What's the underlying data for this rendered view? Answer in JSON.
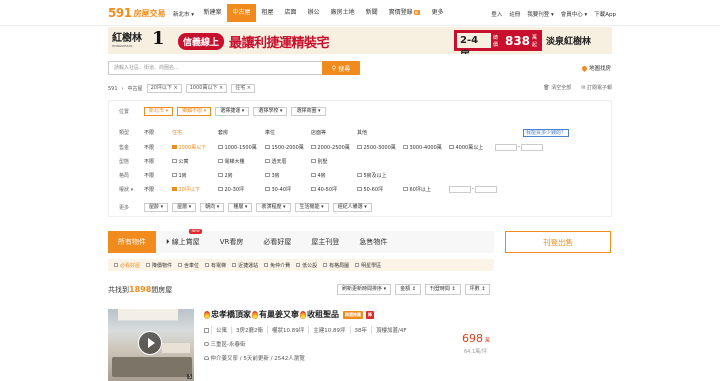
{
  "nav": {
    "logo_num": "591",
    "logo_text": "房屋交易",
    "city": "新北市 ▾",
    "links": [
      "新建案",
      "中古屋",
      "租屋",
      "店面",
      "辦公",
      "廠房土地",
      "新聞",
      "實價登錄",
      "更多"
    ],
    "new_badge": "新",
    "user": [
      "登入",
      "註冊",
      "我要刊登 ▾",
      "會員中心 ▾",
      "下載App"
    ]
  },
  "banner": {
    "brand": "紅樹林",
    "brand_num": "1",
    "brand_sub": "HONGSHULIN",
    "pill": "信義線上",
    "slogan": "最讓利捷運精裝宅",
    "rooms": "2-4房",
    "total_label": "總價",
    "price": "838",
    "price_unit": "萬起",
    "project": "淡泉紅樹林"
  },
  "search": {
    "placeholder": "請輸入社區、街道、商圈名...",
    "button": "搜尋",
    "map": "地圖找房"
  },
  "crumbs": {
    "items": [
      "591",
      "中古屋",
      "20坪以下 ×",
      "1000萬以下 ×",
      "住宅 ×"
    ],
    "right": [
      "清空全部",
      "訂閱電子報"
    ]
  },
  "filters": {
    "location_label": "位置",
    "location_sel": [
      "新北市 ▾",
      "鄉鎮不限 ▾",
      "選擇捷運 ▾",
      "選擇學校 ▾",
      "選擇商圈 ▾"
    ],
    "type_label": "類型",
    "type_opts": [
      "不限",
      "住宅",
      "套房",
      "車位",
      "店面等",
      "其他"
    ],
    "price_label": "售金",
    "price_opts": [
      "不限",
      "1000萬以下",
      "1000-1500萬",
      "1500-2000萬",
      "2000-2500萬",
      "2500-3000萬",
      "3000-4000萬",
      "4000萬以上"
    ],
    "calc": "我能買多少錢的？",
    "shape_label": "型態",
    "shape_opts": [
      "不限",
      "公寓",
      "電梯大樓",
      "透天厝",
      "別墅"
    ],
    "room_label": "格局",
    "room_opts": [
      "不限",
      "1房",
      "2房",
      "3房",
      "4房",
      "5房及以上"
    ],
    "area_label": "權狀 ▾",
    "area_opts": [
      "不限",
      "20坪以下",
      "20-30坪",
      "30-40坪",
      "40-50坪",
      "50-60坪",
      "60坪以上"
    ],
    "more_label": "更多",
    "more_sel": [
      "屋齡 ▾",
      "屋層 ▾",
      "朝向 ▾",
      "樓層 ▾",
      "裝潢程度 ▾",
      "生活機能 ▾",
      "經紀人備選 ▾"
    ]
  },
  "tabs": [
    "所有物件",
    "線上賞屋",
    "VR看房",
    "必看好屋",
    "屋主刊登",
    "急售物件"
  ],
  "tab_new_badge": "NEW",
  "post_button": "刊登出售",
  "subfilters": [
    "必看好屋",
    "降價物件",
    "含車位",
    "有電梯",
    "近捷運站",
    "免仲介費",
    "低公設",
    "有格局圖",
    "明星學區"
  ],
  "results": {
    "prefix": "共找到",
    "count": "1898",
    "suffix": "間房屋"
  },
  "sorts": [
    "刷新更新時間排序 ▾",
    "金額 ↕",
    "刊登時間 ↕",
    "坪數 ↕"
  ],
  "listing": {
    "title": [
      "忠孝橋頂家",
      "有巢姜又寧",
      "收租聖品"
    ],
    "badge1": "精選推薦",
    "badge2": "降",
    "photo_count": "5",
    "specs": [
      "公寓",
      "3房2廳2衛",
      "權狀10.89坪",
      "主建10.89坪",
      "38年",
      "頂樓加蓋/4F"
    ],
    "address": "三重區-永春街",
    "agent": "仲介姜又寧 / 5天前更新 / 2542人瀏覽",
    "price": "698",
    "price_unit": "萬",
    "unit_price": "64.1萬/坪"
  },
  "colors": {
    "accent": "#f28b1e",
    "price": "#e0411b",
    "brand_red": "#c8102e"
  }
}
